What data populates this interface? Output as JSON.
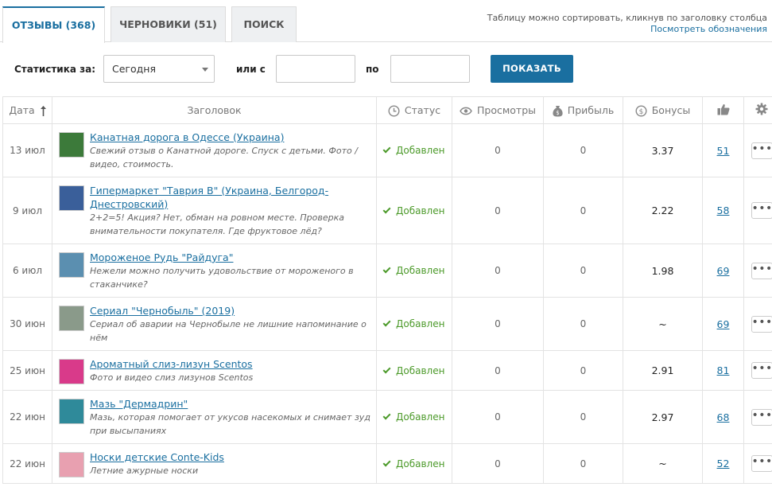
{
  "tabs": [
    {
      "label": "ОТЗЫВЫ (368)",
      "active": true
    },
    {
      "label": "ЧЕРНОВИКИ (51)",
      "active": false
    },
    {
      "label": "ПОИСК",
      "active": false
    }
  ],
  "hint": {
    "text": "Таблицу можно сортировать, кликнув по заголовку столбца",
    "link": "Посмотреть обозначения"
  },
  "filter": {
    "label": "Статистика за:",
    "period_value": "Сегодня",
    "or_from_label": "или с",
    "to_label": "по",
    "from_value": "",
    "to_value": "",
    "show_button": "ПОКАЗАТЬ"
  },
  "table": {
    "headers": {
      "date": "Дата",
      "title": "Заголовок",
      "status": "Статус",
      "views": "Просмотры",
      "profit": "Прибыль",
      "bonus": "Бонусы"
    },
    "rows": [
      {
        "date": "13 июл",
        "title": "Канатная дорога в Одессе (Украина)",
        "desc": "Свежий отзыв о Канатной дороге. Спуск с детьми. Фото / видео, стоимость.",
        "status": "Добавлен",
        "views": "0",
        "profit": "0",
        "bonus": "3.37",
        "likes": "51",
        "thumb_color": "#3c7a3a"
      },
      {
        "date": "9 июл",
        "title": "Гипермаркет \"Таврия В\" (Украина, Белгород-Днестровский)",
        "desc": "2+2=5! Акция? Нет, обман на ровном месте. Проверка внимательности покупателя. Где фруктовое лёд?",
        "status": "Добавлен",
        "views": "0",
        "profit": "0",
        "bonus": "2.22",
        "likes": "58",
        "thumb_color": "#3a5f9a"
      },
      {
        "date": "6 июл",
        "title": "Мороженое Рудь \"Райдуга\"",
        "desc": "Нежели можно получить удовольствие от мороженого в стаканчике?",
        "status": "Добавлен",
        "views": "0",
        "profit": "0",
        "bonus": "1.98",
        "likes": "69",
        "thumb_color": "#5b8fb0"
      },
      {
        "date": "30 июн",
        "title": "Сериал \"Чернобыль\" (2019)",
        "desc": "Сериал об аварии на Чернобыле не лишние напоминание о нём",
        "status": "Добавлен",
        "views": "0",
        "profit": "0",
        "bonus": "~",
        "likes": "69",
        "thumb_color": "#8a9a8a"
      },
      {
        "date": "25 июн",
        "title": "Ароматный слиз-лизун Scentos",
        "desc": "Фото и видео слиз лизунов Scentos",
        "status": "Добавлен",
        "views": "0",
        "profit": "0",
        "bonus": "2.91",
        "likes": "81",
        "thumb_color": "#d93a8a"
      },
      {
        "date": "22 июн",
        "title": "Мазь \"Дермадрин\"",
        "desc": "Мазь, которая помогает от укусов насекомых и снимает зуд при высыпаниях",
        "status": "Добавлен",
        "views": "0",
        "profit": "0",
        "bonus": "2.97",
        "likes": "68",
        "thumb_color": "#2f8a9a"
      },
      {
        "date": "22 июн",
        "title": "Носки детские Conte-Kids",
        "desc": "Летние ажурные носки",
        "status": "Добавлен",
        "views": "0",
        "profit": "0",
        "bonus": "~",
        "likes": "52",
        "thumb_color": "#e8a0b0"
      }
    ]
  },
  "colors": {
    "accent": "#1a6fa0",
    "success": "#4c9a2a"
  }
}
